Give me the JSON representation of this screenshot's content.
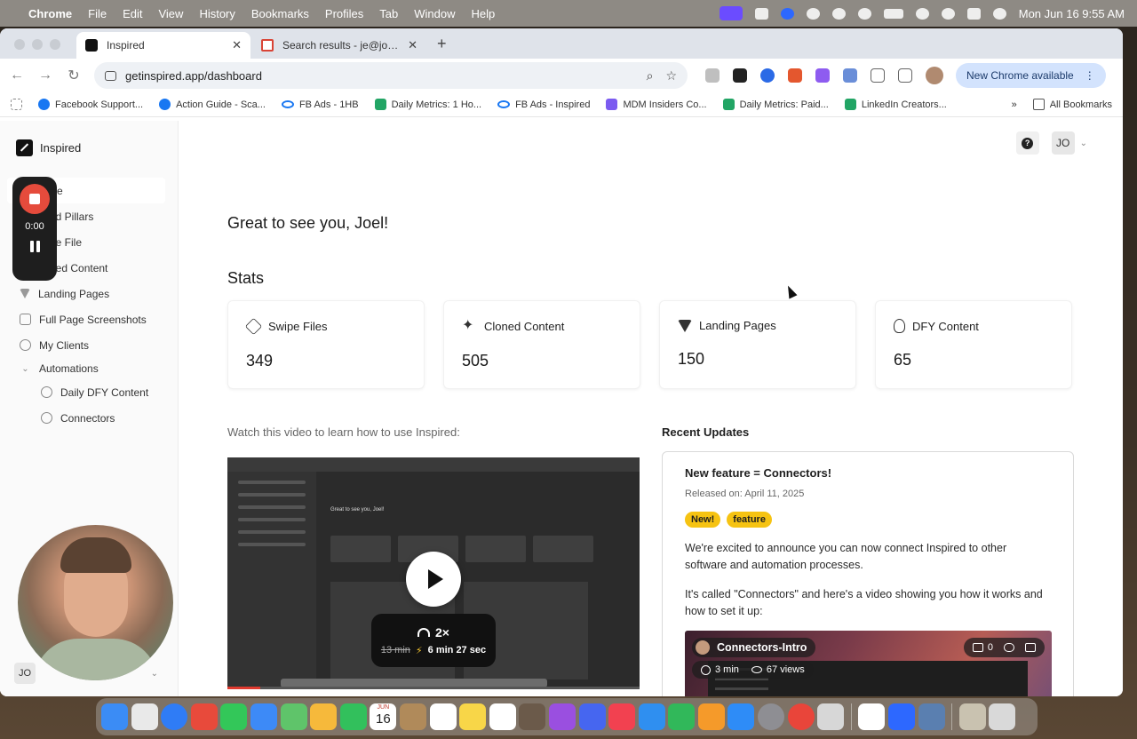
{
  "menubar": {
    "app": "Chrome",
    "items": [
      "File",
      "Edit",
      "View",
      "History",
      "Bookmarks",
      "Profiles",
      "Tab",
      "Window",
      "Help"
    ],
    "datetime": "Mon Jun 16  9:55 AM",
    "status_icons": [
      "screen-share-icon",
      "app-icon",
      "zoom-icon",
      "dots-icon",
      "password-icon",
      "user-icon",
      "battery-icon",
      "wifi-icon",
      "search-icon",
      "control-center-icon",
      "siri-icon"
    ]
  },
  "browser": {
    "tabs": [
      {
        "title": "Inspired",
        "active": true
      },
      {
        "title": "Search results - je@joelerway",
        "active": false
      }
    ],
    "url": "getinspired.app/dashboard",
    "update_label": "New Chrome available",
    "bookmarks": [
      "Facebook Support...",
      "Action Guide - Sca...",
      "FB Ads - 1HB",
      "Daily Metrics: 1 Ho...",
      "FB Ads - Inspired",
      "MDM Insiders Co...",
      "Daily Metrics: Paid...",
      "LinkedIn Creators..."
    ],
    "all_bookmarks": "All Bookmarks",
    "more": "»"
  },
  "sidebar": {
    "brand": "Inspired",
    "items": {
      "home": "me",
      "brand_pillars": "nd Pillars",
      "swipe_file": "pe File",
      "cloned_content": "ned Content",
      "landing_pages": "Landing Pages",
      "screenshots": "Full Page Screenshots",
      "clients": "My Clients",
      "automations": "Automations",
      "daily_dfy": "Daily DFY Content",
      "connectors": "Connectors"
    },
    "user_initials": "JO"
  },
  "header": {
    "help": "?",
    "user_initials": "JO"
  },
  "main": {
    "greeting": "Great to see you, Joel!",
    "stats_title": "Stats",
    "stats": [
      {
        "label": "Swipe Files",
        "value": "349"
      },
      {
        "label": "Cloned Content",
        "value": "505"
      },
      {
        "label": "Landing Pages",
        "value": "150"
      },
      {
        "label": "DFY Content",
        "value": "65"
      }
    ],
    "video_caption": "Watch this video to learn how to use Inspired:",
    "video": {
      "speed": "2×",
      "old_time": "13 min",
      "new_time": "6 min 27 sec",
      "bolt": "⚡",
      "inner_greeting": "Great to see you, Joel!"
    },
    "updates_title": "Recent Updates",
    "update": {
      "title": "New feature = Connectors!",
      "date": "Released on: April 11, 2025",
      "badges": [
        "New!",
        "feature"
      ],
      "p1": "We're excited to announce you can now connect Inspired to other software and automation processes.",
      "p2": "It's called \"Connectors\" and here's a video showing you how it works and how to set it up:",
      "loom_title": "Connectors-Intro",
      "loom_duration": "3 min",
      "loom_views": "67 views",
      "loom_comments": "0"
    }
  },
  "recorder": {
    "time": "0:00"
  },
  "dock": {
    "calendar_month": "JUN",
    "calendar_day": "16"
  }
}
